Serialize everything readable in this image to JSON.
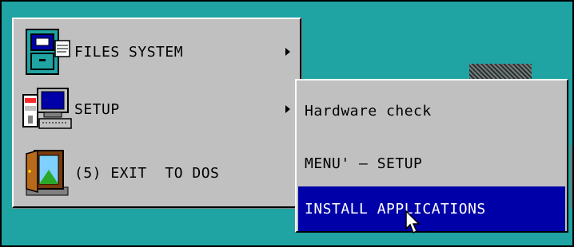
{
  "menu": {
    "items": [
      {
        "label": "FILES SYSTEM",
        "icon": "file-cabinet-icon",
        "has_submenu": true
      },
      {
        "label": "SETUP",
        "icon": "computer-setup-icon",
        "has_submenu": true
      },
      {
        "label": "(5) EXIT  TO DOS",
        "icon": "door-exit-icon",
        "has_submenu": false
      }
    ]
  },
  "submenu": {
    "items": [
      {
        "label": "Hardware check"
      },
      {
        "label": "MENU' – SETUP"
      },
      {
        "label": "INSTALL APPLICATIONS",
        "selected": true
      }
    ]
  },
  "colors": {
    "desktop": "#1fa3a3",
    "menu_bg": "#c0c0c0",
    "selection": "#0000a8",
    "selection_text": "#ffffff"
  }
}
